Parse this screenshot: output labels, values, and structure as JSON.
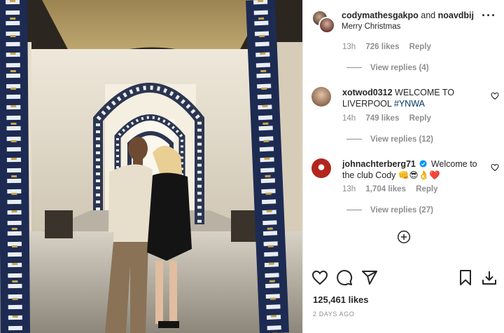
{
  "post": {
    "author_1": "codymathesgakpo",
    "joiner": "and",
    "author_2": "noavdbij",
    "caption": "Merry Christmas",
    "likes": "125,461 likes",
    "date": "2 DAYS AGO"
  },
  "thread": {
    "first_meta": {
      "time": "13h",
      "likes": "726 likes",
      "reply": "Reply"
    },
    "first_view_replies": "View replies (4)",
    "comments": [
      {
        "user": "xotwod0312",
        "text": "WELCOME TO LIVERPOOL",
        "hashtag": "#YNWA",
        "time": "14h",
        "likes": "749 likes",
        "reply": "Reply",
        "view_replies": "View replies (12)"
      },
      {
        "user": "johnachterberg71",
        "text": "Welcome to the club Cody 👊😎👌❤️",
        "time": "13h",
        "likes": "1,704 likes",
        "reply": "Reply",
        "view_replies": "View replies (27)"
      }
    ]
  },
  "icons": {
    "more": "more-options-icon",
    "heart": "heart-icon",
    "add": "add-circle-icon",
    "comment": "comment-icon",
    "share": "share-icon",
    "save": "bookmark-icon",
    "download": "download-icon",
    "verified": "verified-badge-icon"
  },
  "colors": {
    "link": "#00376b",
    "muted": "#8e8e8e",
    "text": "#262626",
    "verified": "#0095f6"
  }
}
